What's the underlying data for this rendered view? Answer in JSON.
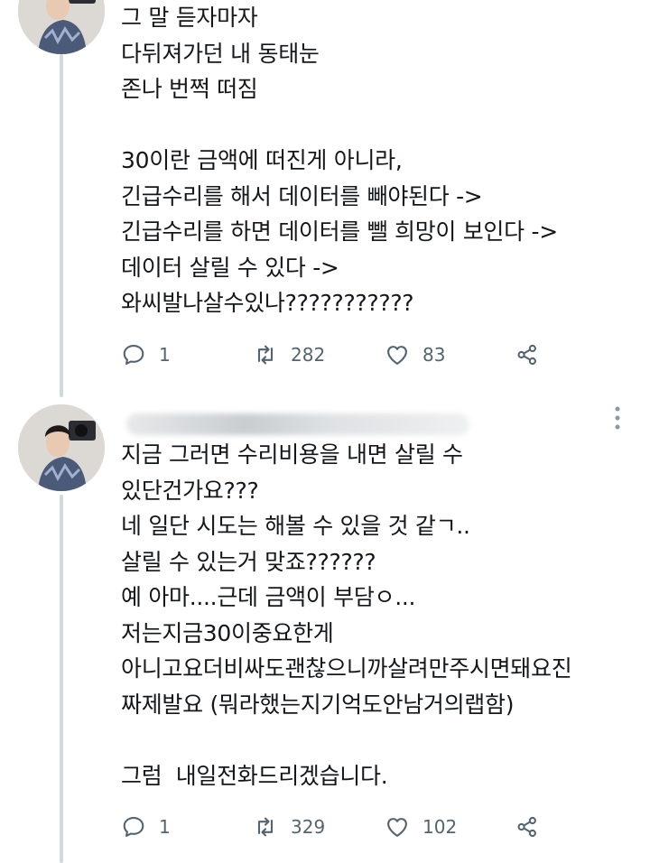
{
  "tweets": [
    {
      "text": "그 말 듣자마자\n다뒤져가던 내 동태눈\n존나 번쩍 떠짐\n\n30이란 금액에 떠진게 아니라,\n긴급수리를 해서 데이터를 빼야된다 ->\n긴급수리를 하면 데이터를 뺄 희망이 보인다 ->\n데이터 살릴 수 있다 ->\n와씨발나살수있나???????????",
      "actions": {
        "replies": "1",
        "retweets": "282",
        "likes": "83"
      }
    },
    {
      "text": "지금 그러면 수리비용을 내면 살릴 수\n있단건가요???\n네 일단 시도는 해볼 수 있을 것 같ㄱ..\n살릴 수 있는거 맞죠??????\n예 아마....근데 금액이 부담ㅇ...\n저는지금30이중요한게\n아니고요더비싸도괜찮으니까살려만주시면돼요진\n짜제발요 (뭐라했는지기억도안남거의랩함)\n\n그럼  내일전화드리겠습니다.",
      "actions": {
        "replies": "1",
        "retweets": "329",
        "likes": "102"
      }
    }
  ],
  "icons": {
    "reply": "speech-bubble-icon",
    "retweet": "retweet-arrows-icon",
    "like": "heart-icon",
    "share": "share-icon",
    "more": "vertical-ellipsis-icon"
  },
  "colors": {
    "icon_gray": "#536471",
    "thread_line": "#cfd9de",
    "text": "#14171a"
  }
}
